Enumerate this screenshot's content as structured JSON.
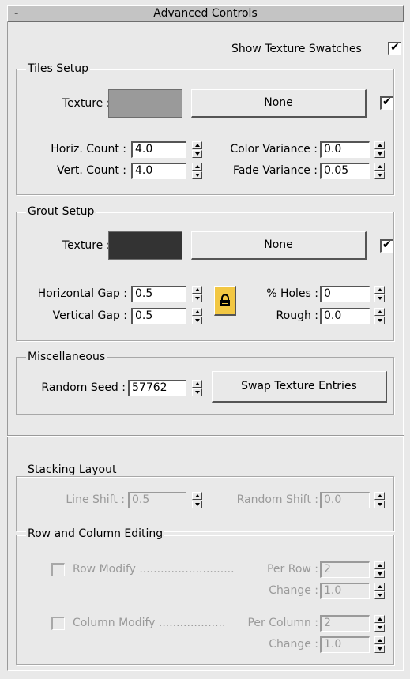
{
  "rollout": {
    "collapse_glyph": "-",
    "title": "Advanced Controls"
  },
  "show_swatches": {
    "label": "Show Texture Swatches",
    "checked": true
  },
  "tiles_setup": {
    "title": "Tiles Setup",
    "texture_label": "Texture :",
    "texture_color": "#9a9a9a",
    "texture_button": "None",
    "texture_enabled": true,
    "horiz_count_label": "Horiz. Count :",
    "horiz_count": "4.0",
    "vert_count_label": "Vert. Count :",
    "vert_count": "4.0",
    "color_variance_label": "Color Variance :",
    "color_variance": "0.0",
    "fade_variance_label": "Fade Variance :",
    "fade_variance": "0.05"
  },
  "grout_setup": {
    "title": "Grout Setup",
    "texture_label": "Texture :",
    "texture_color": "#333333",
    "texture_button": "None",
    "texture_enabled": true,
    "h_gap_label": "Horizontal Gap :",
    "h_gap": "0.5",
    "v_gap_label": "Vertical Gap :",
    "v_gap": "0.5",
    "holes_label": "% Holes :",
    "holes": "0",
    "rough_label": "Rough :",
    "rough": "0.0",
    "lock_color": "#f2c743"
  },
  "misc": {
    "title": "Miscellaneous",
    "seed_label": "Random Seed :",
    "seed": "57762",
    "swap_button": "Swap Texture Entries"
  },
  "stacking": {
    "title": "Stacking Layout",
    "line_shift_label": "Line Shift :",
    "line_shift": "0.5",
    "random_shift_label": "Random Shift :",
    "random_shift": "0.0"
  },
  "row_col": {
    "title": "Row and Column Editing",
    "row_modify_label": "Row Modify ...........................",
    "per_row_label": "Per Row :",
    "per_row": "2",
    "row_change_label": "Change :",
    "row_change": "1.0",
    "col_modify_label": "Column Modify ...................",
    "per_col_label": "Per Column :",
    "per_col": "2",
    "col_change_label": "Change :",
    "col_change": "1.0"
  }
}
